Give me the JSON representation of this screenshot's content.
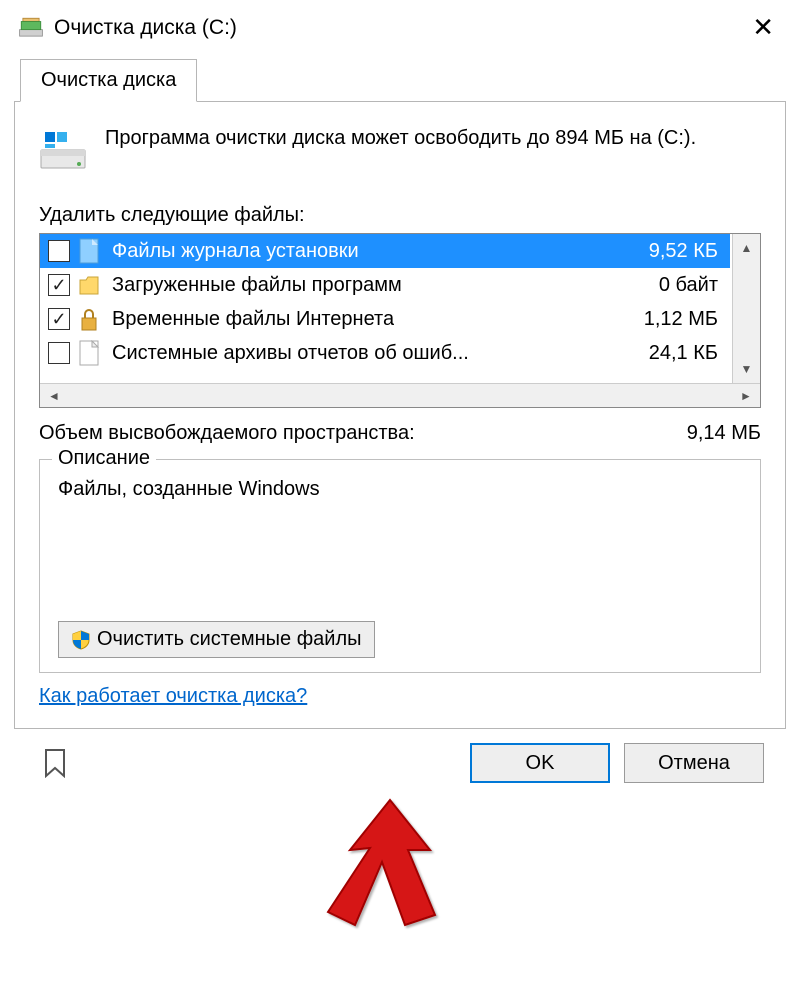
{
  "window": {
    "title": "Очистка диска  (C:)"
  },
  "tab": {
    "label": "Очистка диска"
  },
  "intro": {
    "text": "Программа очистки диска может освободить до 894 МБ на  (C:)."
  },
  "delete_label": "Удалить следующие файлы:",
  "files": [
    {
      "name": "Файлы журнала установки",
      "size": "9,52 КБ",
      "checked": false,
      "selected": true,
      "icon": "page-blue"
    },
    {
      "name": "Загруженные файлы программ",
      "size": "0 байт",
      "checked": true,
      "selected": false,
      "icon": "folder"
    },
    {
      "name": "Временные файлы Интернета",
      "size": "1,12 МБ",
      "checked": true,
      "selected": false,
      "icon": "lock"
    },
    {
      "name": "Системные архивы отчетов об ошиб...",
      "size": "24,1 КБ",
      "checked": false,
      "selected": false,
      "icon": "page"
    }
  ],
  "freed": {
    "label": "Объем высвобождаемого пространства:",
    "value": "9,14 МБ"
  },
  "description": {
    "legend": "Описание",
    "text": "Файлы, созданные Windows"
  },
  "system_files_btn": "Очистить системные файлы",
  "help_link": "Как работает очистка диска?",
  "buttons": {
    "ok": "OK",
    "cancel": "Отмена"
  }
}
